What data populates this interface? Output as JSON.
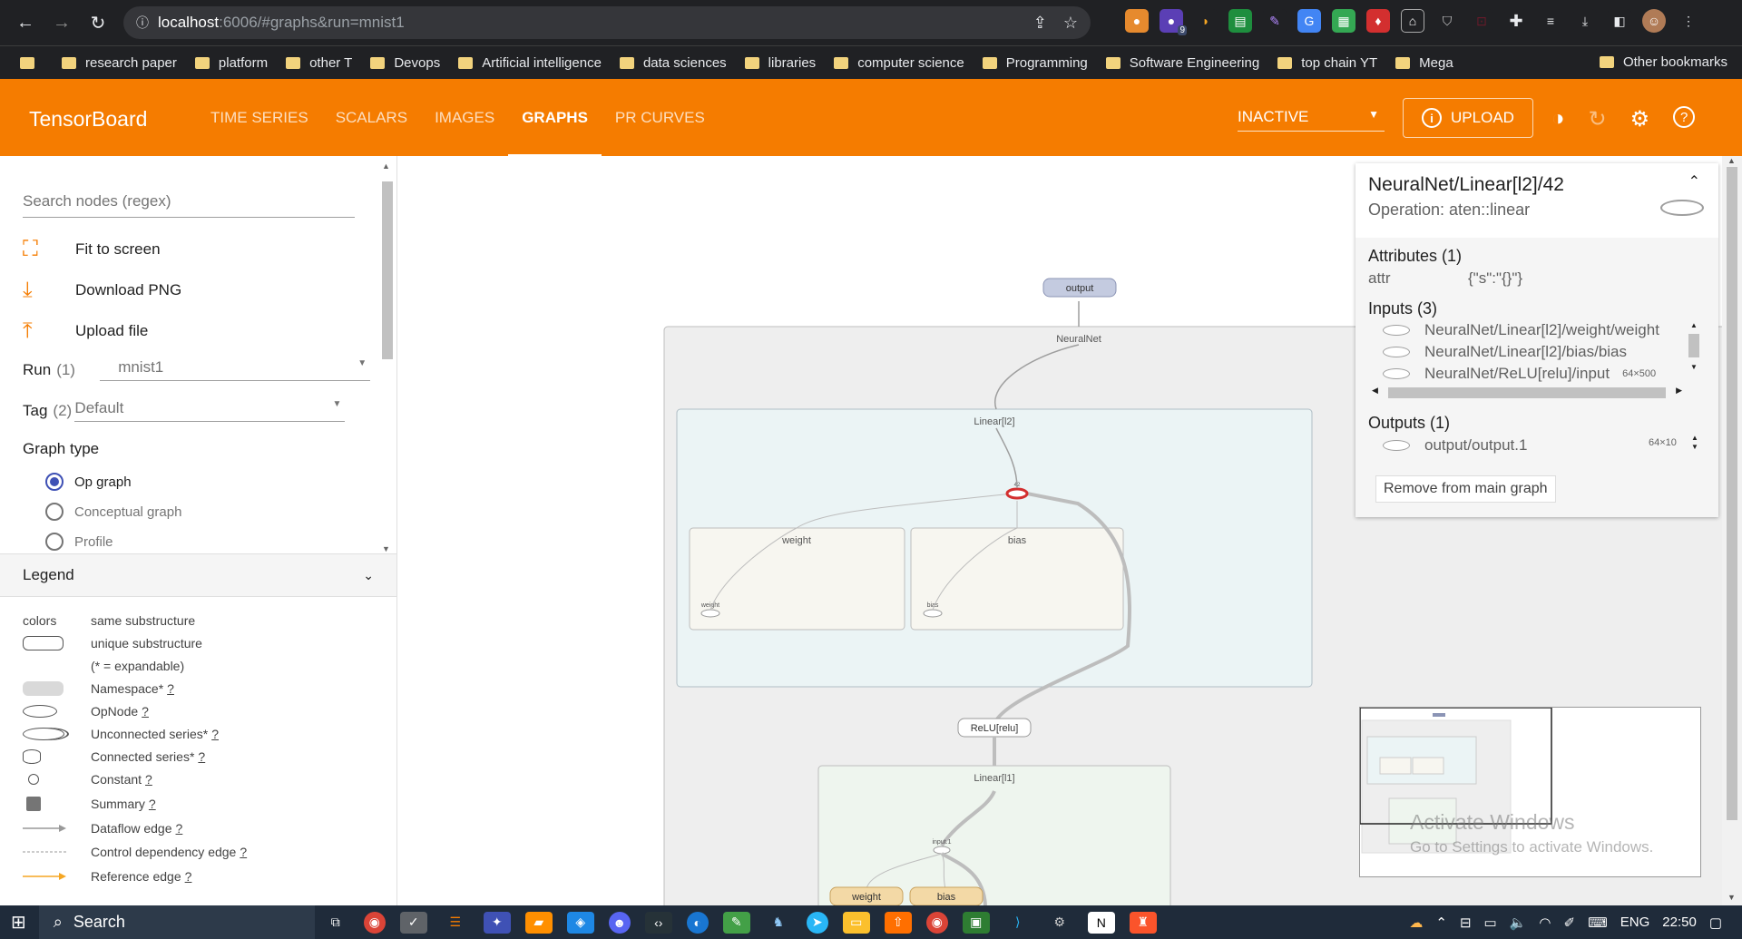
{
  "browser": {
    "url_host": "localhost",
    "url_path": ":6006/#graphs&run=mnist1",
    "bookmarks": [
      "research paper",
      "platform",
      "other T",
      "Devops",
      "Artificial intelligence",
      "data sciences",
      "libraries",
      "computer science",
      "Programming",
      "Software Engineering",
      "top chain YT",
      "Mega"
    ],
    "other_bookmarks": "Other bookmarks",
    "extension_badge": "9"
  },
  "header": {
    "logo": "TensorBoard",
    "tabs": [
      "TIME SERIES",
      "SCALARS",
      "IMAGES",
      "GRAPHS",
      "PR CURVES"
    ],
    "active_tab": "GRAPHS",
    "status": "INACTIVE",
    "upload_label": "UPLOAD"
  },
  "sidebar": {
    "search_placeholder": "Search nodes (regex)",
    "actions": [
      "Fit to screen",
      "Download PNG",
      "Upload file"
    ],
    "run_label": "Run",
    "run_count": "(1)",
    "run_value": "mnist1",
    "tag_label": "Tag",
    "tag_count": "(2)",
    "tag_value": "Default",
    "graph_type_title": "Graph type",
    "graph_types": [
      "Op graph",
      "Conceptual graph",
      "Profile"
    ],
    "selected_graph_type": "Op graph",
    "legend_title": "Legend",
    "legend": [
      {
        "sym": "colors",
        "label": "same substructure"
      },
      {
        "sym": "",
        "label": "unique substructure"
      },
      {
        "sym": "",
        "label": "(* = expandable)"
      },
      {
        "sym": "",
        "label": "Namespace*",
        "help": "?"
      },
      {
        "sym": "",
        "label": "OpNode",
        "help": "?"
      },
      {
        "sym": "",
        "label": "Unconnected series*",
        "help": "?"
      },
      {
        "sym": "",
        "label": "Connected series*",
        "help": "?"
      },
      {
        "sym": "",
        "label": "Constant",
        "help": "?"
      },
      {
        "sym": "",
        "label": "Summary",
        "help": "?"
      },
      {
        "sym": "",
        "label": "Dataflow edge",
        "help": "?"
      },
      {
        "sym": "",
        "label": "Control dependency edge",
        "help": "?"
      },
      {
        "sym": "",
        "label": "Reference edge",
        "help": "?"
      }
    ]
  },
  "graph": {
    "nodes": {
      "output": "output",
      "neuralnet": "NeuralNet",
      "linear_l2": "Linear[l2]",
      "weight_ns": "weight",
      "bias_ns": "bias",
      "weight_op": "weight",
      "bias_op": "bias",
      "relu": "ReLU[relu]",
      "linear_l1": "Linear[l1]",
      "input1": "input.1",
      "weight_l1": "weight",
      "bias_l1": "bias",
      "node42": "42"
    }
  },
  "info_panel": {
    "title": "NeuralNet/Linear[l2]/42",
    "operation": "Operation: aten::linear",
    "attributes_title": "Attributes (1)",
    "attr_key": "attr",
    "attr_value": "{\"s\":\"{}\"}",
    "inputs_title": "Inputs (3)",
    "inputs": [
      "NeuralNet/Linear[l2]/weight/weight",
      "NeuralNet/Linear[l2]/bias/bias",
      "NeuralNet/ReLU[relu]/input"
    ],
    "input_dim": "64×500",
    "outputs_title": "Outputs (1)",
    "outputs": [
      "output/output.1"
    ],
    "output_dim": "64×10",
    "remove_button": "Remove from main graph"
  },
  "watermark": {
    "line1": "Activate Windows",
    "line2": "Go to Settings to activate Windows."
  },
  "taskbar": {
    "search": "Search",
    "lang": "ENG",
    "time": "22:50"
  },
  "colors": {
    "accent": "#f57c00",
    "selected": "#3f51b5",
    "highlight_node": "#d32f2f"
  }
}
